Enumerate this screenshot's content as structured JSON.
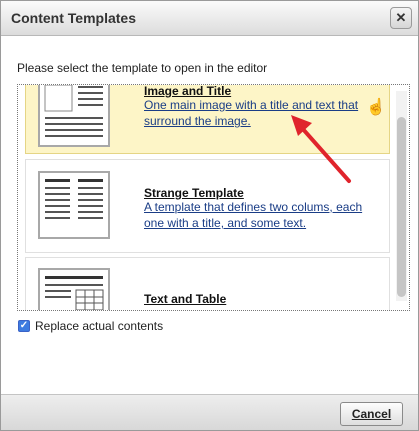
{
  "dialog": {
    "title": "Content Templates",
    "close_icon": "close-icon"
  },
  "prompt": "Please select the template to open in the editor",
  "templates": [
    {
      "name": "Image and Title",
      "description": "One main image with a title and text that surround the image.",
      "selected": true,
      "thumbnail_icon": "image-and-title-thumbnail"
    },
    {
      "name": "Strange Template",
      "description": "A template that defines two colums, each one with a title, and some text.",
      "selected": false,
      "thumbnail_icon": "two-columns-thumbnail"
    },
    {
      "name": "Text and Table",
      "description": "",
      "selected": false,
      "thumbnail_icon": "text-and-table-thumbnail"
    }
  ],
  "replace_contents": {
    "label": "Replace actual contents",
    "checked": true
  },
  "footer": {
    "cancel_label": "Cancel"
  },
  "colors": {
    "selected_background": "#fdf5c7",
    "link_text": "#1a3d86",
    "annotation_arrow": "#e0242c"
  }
}
